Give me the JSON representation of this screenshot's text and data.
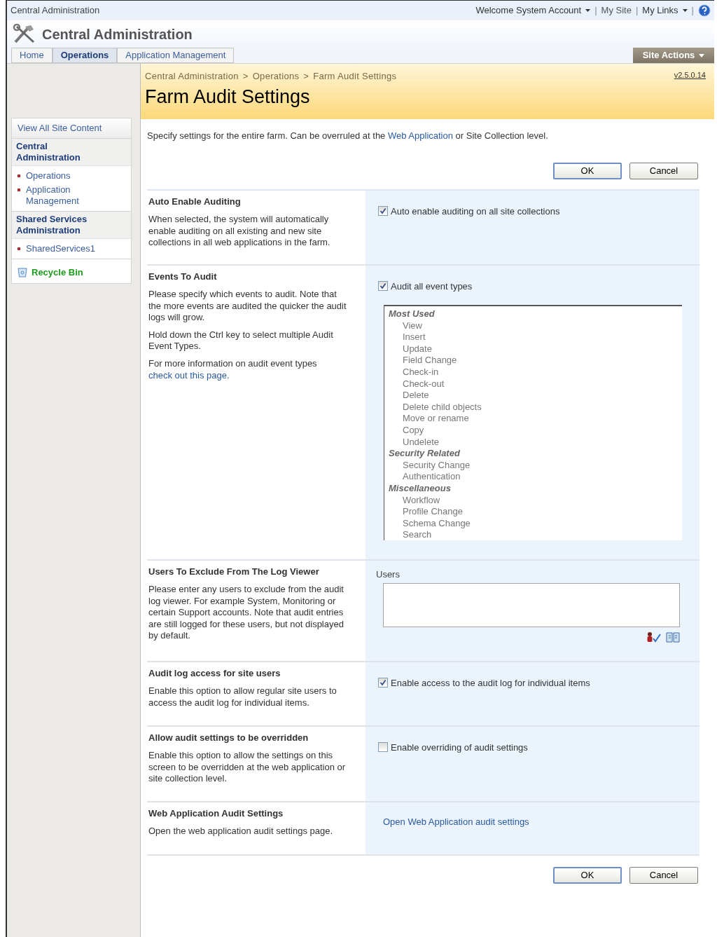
{
  "top_bar": {
    "site_name": "Central Administration",
    "welcome": "Welcome System Account",
    "separator": "|",
    "my_site": "My Site",
    "my_links": "My Links"
  },
  "header": {
    "title": "Central Administration"
  },
  "tabs": [
    {
      "label": "Home",
      "selected": false
    },
    {
      "label": "Operations",
      "selected": true
    },
    {
      "label": "Application Management",
      "selected": false
    }
  ],
  "site_actions": "Site Actions",
  "breadcrumb": {
    "items": [
      "Central Administration",
      "Operations",
      "Farm Audit Settings"
    ],
    "separator": ">"
  },
  "version": "v2.5.0.14",
  "page_title": "Farm Audit Settings",
  "sidebar": {
    "view_all": "View All Site Content",
    "groups": [
      {
        "heading": "Central Administration",
        "items": [
          "Operations",
          "Application Management"
        ]
      },
      {
        "heading": "Shared Services Administration",
        "items": [
          "SharedServices1"
        ]
      }
    ],
    "recycle_bin": "Recycle Bin"
  },
  "intro": {
    "before": "Specify settings for the entire farm. Can be overruled at the ",
    "link": "Web Application",
    "after": " or Site Collection level."
  },
  "top_buttons": [
    "OK",
    "Cancel"
  ],
  "sections": [
    {
      "kind": "checkbox",
      "title": "Auto Enable Auditing",
      "paragraphs": [
        {
          "text": "When selected, the system will automatically enable auditing on all existing and new site collections in all web applications in the farm."
        }
      ],
      "checkbox": {
        "label": "Auto enable auditing on all site collections",
        "checked": true
      }
    },
    {
      "kind": "listbox",
      "title": "Events To Audit",
      "paragraphs": [
        {
          "text": "Please specify which events to audit. Note that the more events are audited the quicker the audit logs will grow."
        },
        {
          "text": "Hold down the Ctrl key to select multiple Audit Event Types."
        },
        {
          "text": "For more information on audit event types",
          "link": "check out this page."
        }
      ],
      "checkbox": {
        "label": "Audit all event types",
        "checked": true
      },
      "groups": [
        {
          "label": "Most Used",
          "items": [
            "View",
            "Insert",
            "Update",
            "Field Change",
            "Check-in",
            "Check-out",
            "Delete",
            "Delete child objects",
            "Move or rename",
            "Copy",
            "Undelete"
          ]
        },
        {
          "label": "Security Related",
          "items": [
            "Security Change",
            "Authentication"
          ]
        },
        {
          "label": "Miscellaneous",
          "items": [
            "Workflow",
            "Profile Change",
            "Schema Change",
            "Search"
          ]
        }
      ]
    },
    {
      "kind": "people",
      "title": "Users To Exclude From The Log Viewer",
      "paragraphs": [
        {
          "text": "Please enter any users to exclude from the audit log viewer. For example System, Monitoring or certain Support accounts. Note that audit entries are still logged for these users, but not displayed by default."
        }
      ],
      "field_label": "Users"
    },
    {
      "kind": "checkbox",
      "title": "Audit log access for site users",
      "paragraphs": [
        {
          "text": "Enable this option to allow regular site users to access the audit log for individual items."
        }
      ],
      "checkbox": {
        "label": "Enable access to the audit log for individual items",
        "checked": true
      }
    },
    {
      "kind": "checkbox",
      "title": "Allow audit settings to be overridden",
      "paragraphs": [
        {
          "text": "Enable this option to allow the settings on this screen to be overridden at the web application or site collection level."
        }
      ],
      "checkbox": {
        "label": "Enable overriding of audit settings",
        "checked": false
      }
    },
    {
      "kind": "link",
      "title": "Web Application Audit Settings",
      "paragraphs": [
        {
          "text": "Open the web application audit settings page."
        }
      ],
      "link": "Open Web Application audit settings"
    }
  ],
  "bottom_buttons": [
    "OK",
    "Cancel"
  ]
}
